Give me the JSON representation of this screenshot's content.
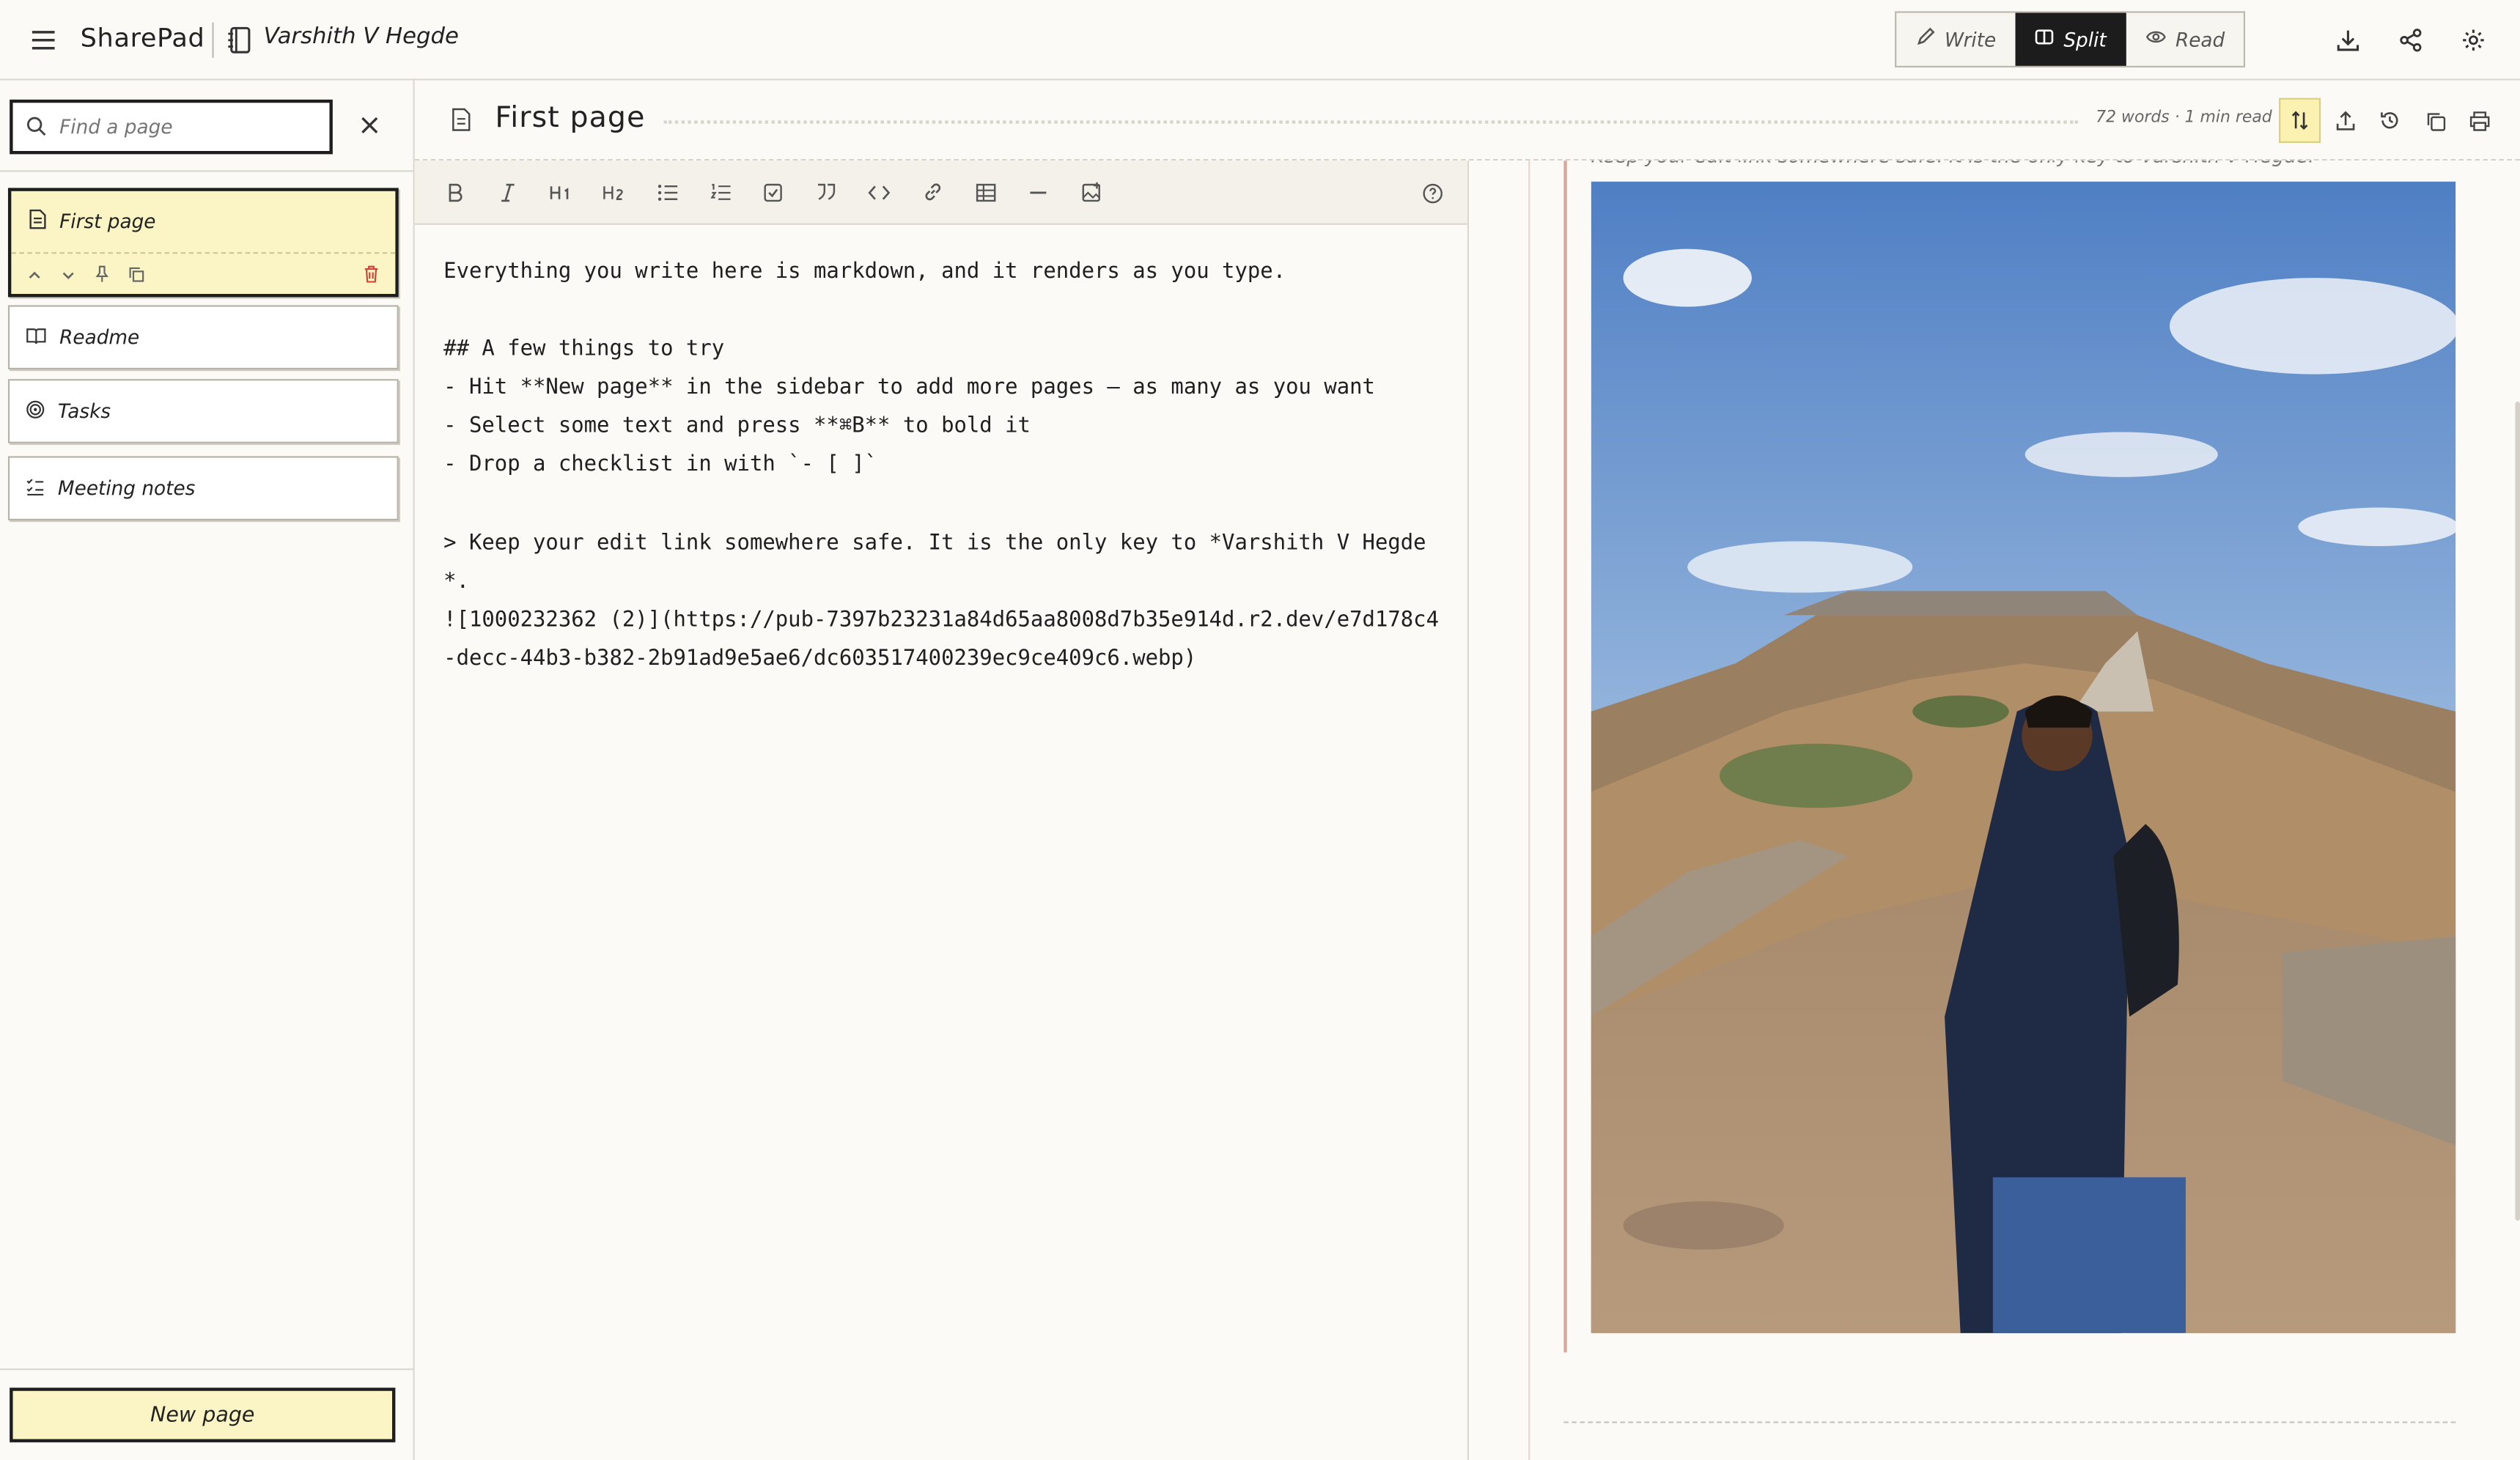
{
  "app": {
    "name": "SharePad",
    "notebook": "Varshith V Hegde"
  },
  "modes": [
    {
      "label": "Write",
      "icon": "pencil-icon",
      "active": false
    },
    {
      "label": "Split",
      "icon": "split-icon",
      "active": true
    },
    {
      "label": "Read",
      "icon": "eye-icon",
      "active": false
    }
  ],
  "search": {
    "placeholder": "Find a page",
    "value": ""
  },
  "pages": [
    {
      "label": "First page",
      "icon": "document-icon",
      "active": true
    },
    {
      "label": "Readme",
      "icon": "book-icon",
      "active": false
    },
    {
      "label": "Tasks",
      "icon": "target-icon",
      "active": false
    },
    {
      "label": "Meeting notes",
      "icon": "checklist-icon",
      "active": false
    }
  ],
  "new_page_label": "New page",
  "page": {
    "title": "First page",
    "meta": "72 words · 1 min read"
  },
  "editor": {
    "text": "Everything you write here is markdown, and it renders as you type.\n\n## A few things to try\n- Hit **New page** in the sidebar to add more pages — as many as you want\n- Select some text and press **⌘B** to bold it\n- Drop a checklist in with `- [ ]`\n\n> Keep your edit link somewhere safe. It is the only key to *Varshith V Hegde*.\n![1000232362 (2)](https://pub-7397b23231a84d65aa8008d7b35e914d.r2.dev/e7d178c4-decc-44b3-b382-2b91ad9e5ae6/dc603517400239ec9ce409c6.webp)"
  },
  "preview": {
    "quote": "Keep your edit link somewhere safe. It is the only key to Varshith V Hegde.",
    "image_alt": "1000232362 (2)"
  },
  "colors": {
    "accent_yellow": "#fbf5c5",
    "ink": "#1e1e1e",
    "paper": "#fbfaf7",
    "delete_red": "#d0443a"
  }
}
